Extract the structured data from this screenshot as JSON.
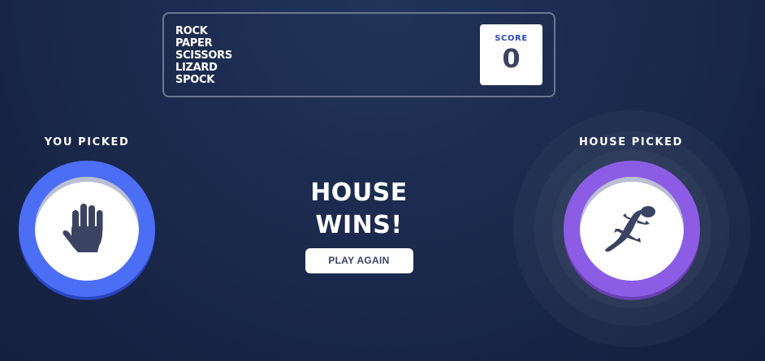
{
  "header": {
    "title_lines": [
      "ROCK",
      "PAPER",
      "SCISSORS",
      "LIZARD",
      "SPOCK"
    ],
    "score_label": "SCORE",
    "score_value": "0"
  },
  "player": {
    "label": "YOU PICKED",
    "choice_icon": "paper-hand-icon",
    "ring_color": "#4c6ef5"
  },
  "house": {
    "label": "HOUSE PICKED",
    "choice_icon": "lizard-icon",
    "ring_color": "#8c5de4"
  },
  "result": {
    "text": "HOUSE WINS!",
    "play_again_label": "PLAY AGAIN"
  },
  "colors": {
    "background_top": "#213559",
    "background_bottom": "#151f3e",
    "icon_color": "#3b4363",
    "score_label_color": "#2a46c0"
  }
}
